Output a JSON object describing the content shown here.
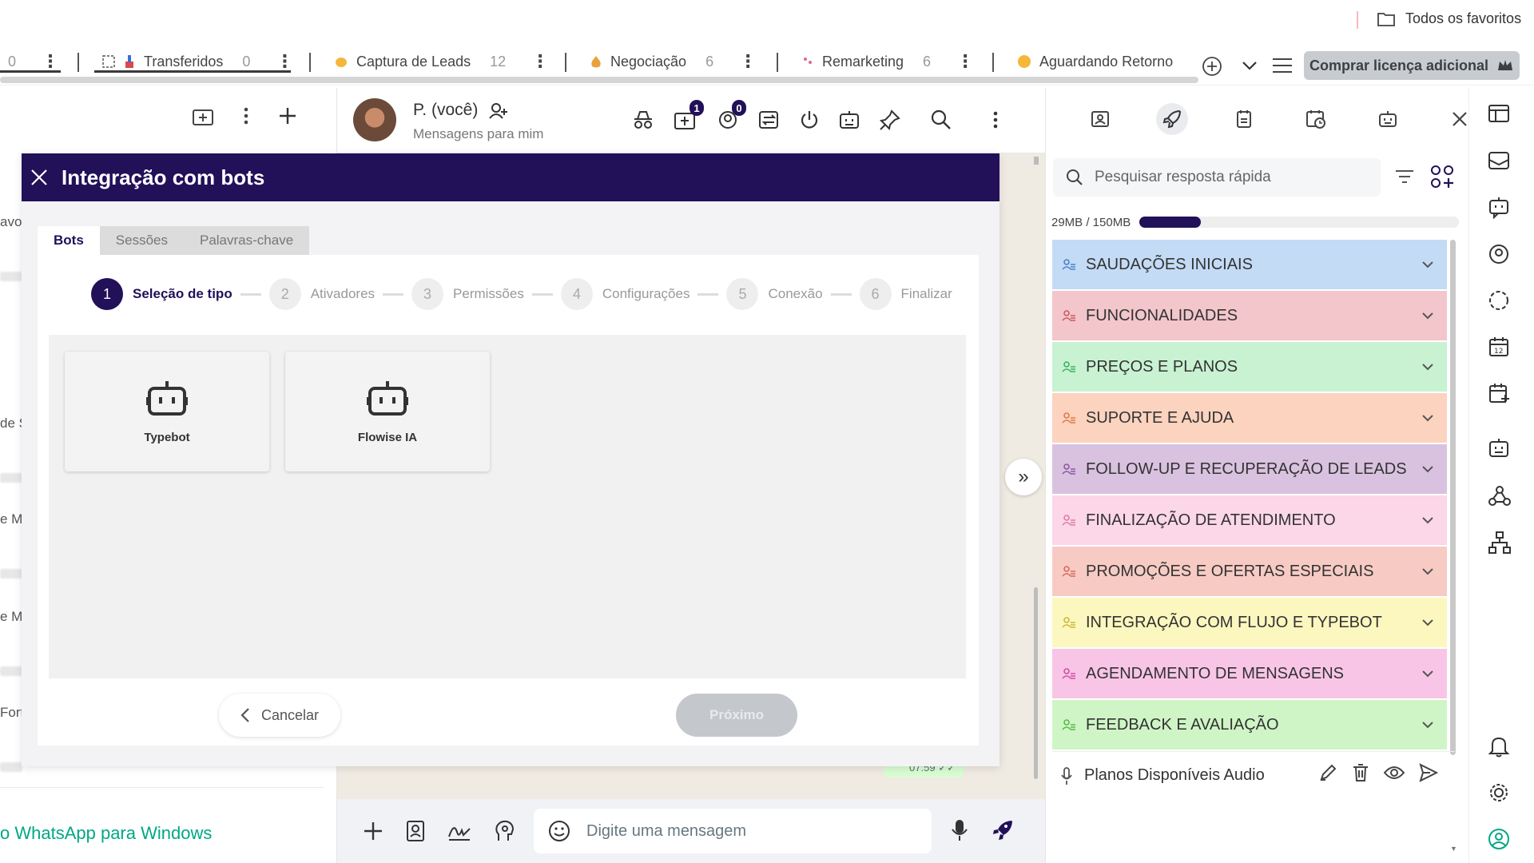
{
  "bookmarks": {
    "all_favorites": "Todos os favoritos"
  },
  "tabs": {
    "items": [
      {
        "label": "",
        "count": "0"
      },
      {
        "label": "Transferidos",
        "count": "0"
      },
      {
        "label": "Captura de Leads",
        "count": "12"
      },
      {
        "label": "Negociação",
        "count": "6"
      },
      {
        "label": "Remarketing",
        "count": "6"
      },
      {
        "label": "Aguardando Retorno",
        "count": ""
      }
    ],
    "buy_button": "Comprar licença adicional"
  },
  "left": {
    "peeks": [
      "avo",
      "de S",
      "e M",
      "e M",
      "Fort"
    ],
    "whatsapp_windows": "o WhatsApp para Windows"
  },
  "conversation": {
    "contact_name": "P. (você)",
    "contact_sub": "Mensagens para mim",
    "badges": [
      "1",
      "0"
    ],
    "time": "07:59",
    "composer_placeholder": "Digite uma mensagem"
  },
  "modal": {
    "title": "Integração com bots",
    "tabs": [
      "Bots",
      "Sessões",
      "Palavras-chave"
    ],
    "steps": [
      {
        "num": "1",
        "label": "Seleção de tipo"
      },
      {
        "num": "2",
        "label": "Ativadores"
      },
      {
        "num": "3",
        "label": "Permissões"
      },
      {
        "num": "4",
        "label": "Configurações"
      },
      {
        "num": "5",
        "label": "Conexão"
      },
      {
        "num": "6",
        "label": "Finalizar"
      }
    ],
    "bots": [
      "Typebot",
      "Flowise IA"
    ],
    "cancel": "Cancelar",
    "next": "Próximo"
  },
  "quick_replies": {
    "search_placeholder": "Pesquisar resposta rápida",
    "storage_label": "29MB / 150MB",
    "storage_fraction": 0.193,
    "categories": [
      {
        "label": "SAUDAÇÕES INICIAIS",
        "color": "#c4dbf6",
        "icon": "#4a82c8"
      },
      {
        "label": "FUNCIONALIDADES",
        "color": "#f2c6cb",
        "icon": "#d0575f"
      },
      {
        "label": "PREÇOS E PLANOS",
        "color": "#c8f2d2",
        "icon": "#3fae63"
      },
      {
        "label": "SUPORTE E AJUDA",
        "color": "#fbd3bf",
        "icon": "#e07a46"
      },
      {
        "label": "FOLLOW-UP E RECUPERAÇÃO DE LEADS",
        "color": "#d9c2df",
        "icon": "#8e56a0"
      },
      {
        "label": "FINALIZAÇÃO DE ATENDIMENTO",
        "color": "#fbd7e8",
        "icon": "#e27aa8"
      },
      {
        "label": "PROMOÇÕES E OFERTAS ESPECIAIS",
        "color": "#f7cbc4",
        "icon": "#d66a5b"
      },
      {
        "label": "INTEGRAÇÃO COM FLUJO E TYPEBOT",
        "color": "#fcf7bf",
        "icon": "#c9b93a"
      },
      {
        "label": "AGENDAMENTO DE MENSAGENS",
        "color": "#f8c5e7",
        "icon": "#d04fa5"
      },
      {
        "label": "FEEDBACK E AVALIAÇÃO",
        "color": "#cff5c6",
        "icon": "#57b947"
      }
    ],
    "audio_item": "Planos Disponíveis Audio"
  }
}
